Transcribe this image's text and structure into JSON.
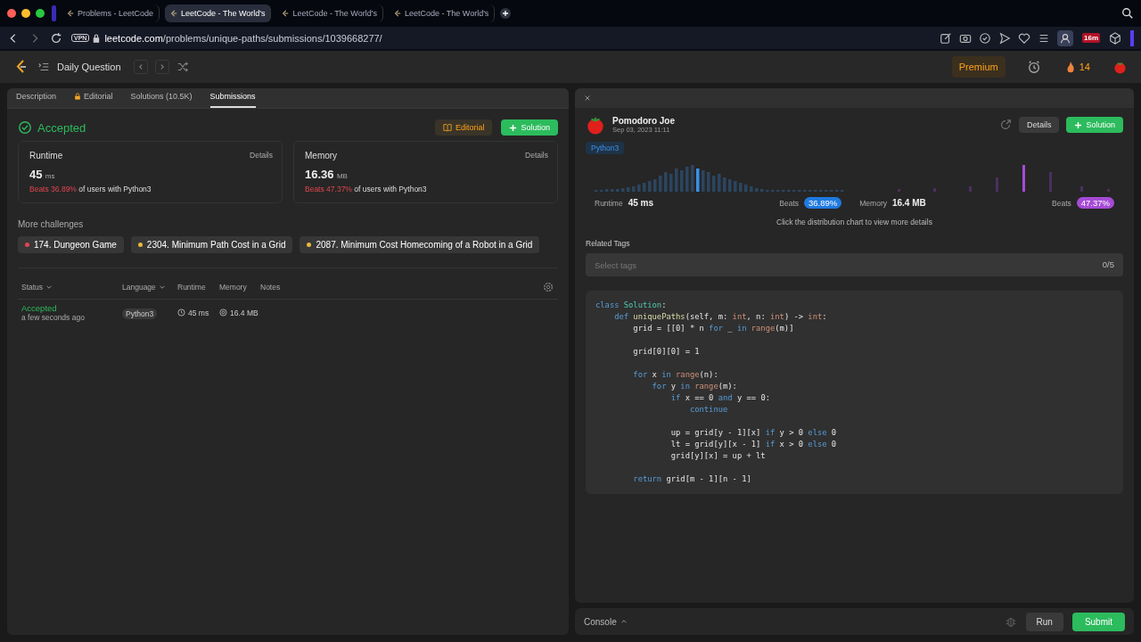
{
  "browser": {
    "tabs": [
      {
        "label": "Problems - LeetCode",
        "selected": false
      },
      {
        "label": "LeetCode - The World's",
        "selected": true
      },
      {
        "label": "LeetCode - The World's",
        "selected": false
      },
      {
        "label": "LeetCode - The World's",
        "selected": false
      }
    ],
    "url_host": "leetcode.com",
    "url_path": "/problems/unique-paths/submissions/1039668277/",
    "vpn": "VPN",
    "timer_badge": "16m"
  },
  "header": {
    "title": "Daily Question",
    "premium": "Premium",
    "streak": "14"
  },
  "left": {
    "tabs": [
      {
        "label": "Description",
        "selected": false,
        "locked": false
      },
      {
        "label": "Editorial",
        "selected": false,
        "locked": true
      },
      {
        "label": "Solutions (10.5K)",
        "selected": false,
        "locked": false
      },
      {
        "label": "Submissions",
        "selected": true,
        "locked": false
      }
    ],
    "status": "Accepted",
    "editorial_button": "Editorial",
    "solution_button": "Solution",
    "stats": [
      {
        "title": "Runtime",
        "details": "Details",
        "value": "45",
        "unit": "ms",
        "beats": "Beats 36.89%",
        "suffix": "of users with Python3"
      },
      {
        "title": "Memory",
        "details": "Details",
        "value": "16.36",
        "unit": "MB",
        "beats": "Beats 47.37%",
        "suffix": "of users with Python3"
      }
    ],
    "more_title": "More challenges",
    "challenges": [
      {
        "label": "174. Dungeon Game",
        "color": "#e0454f"
      },
      {
        "label": "2304. Minimum Path Cost in a Grid",
        "color": "#e8b93a"
      },
      {
        "label": "2087. Minimum Cost Homecoming of a Robot in a Grid",
        "color": "#e8b93a"
      }
    ],
    "columns": [
      {
        "label": "Status",
        "sortable": true
      },
      {
        "label": "Language",
        "sortable": true
      },
      {
        "label": "Runtime",
        "sortable": false
      },
      {
        "label": "Memory",
        "sortable": false
      },
      {
        "label": "Notes",
        "sortable": false
      }
    ],
    "rows": [
      {
        "status": "Accepted",
        "time": "a few seconds ago",
        "language": "Python3",
        "runtime": "45 ms",
        "memory": "16.4 MB"
      }
    ]
  },
  "right": {
    "author": "Pomodoro Joe",
    "date": "Sep 03, 2023 11:11",
    "details_button": "Details",
    "solution_button": "Solution",
    "language": "Python3",
    "runtime_label": "Runtime",
    "runtime": "45 ms",
    "runtime_beats_label": "Beats",
    "runtime_beats": "36.89%",
    "memory_label": "Memory",
    "memory": "16.4 MB",
    "memory_beats_label": "Beats",
    "memory_beats": "47.37%",
    "chart_hint": "Click the distribution chart to view more details",
    "tags_label": "Related Tags",
    "tags_placeholder": "Select tags",
    "tags_count": "0/5",
    "code_blocks": [
      {
        "lines": [
          [
            {
              "kind": "keyword",
              "text": "class"
            },
            {
              "kind": "type",
              "text": " Solution"
            },
            {
              "kind": "plain",
              "text": ":"
            }
          ],
          [
            {
              "kind": "keyword",
              "text": "    def"
            },
            {
              "kind": "function",
              "text": " uniquePaths"
            },
            {
              "kind": "plain",
              "text": "(self, m: "
            },
            {
              "kind": "builtin",
              "text": "int"
            },
            {
              "kind": "plain",
              "text": ", n: "
            },
            {
              "kind": "builtin",
              "text": "int"
            },
            {
              "kind": "plain",
              "text": ") -> "
            },
            {
              "kind": "builtin",
              "text": "int"
            },
            {
              "kind": "plain",
              "text": ":"
            }
          ],
          [
            {
              "kind": "plain",
              "text": "        grid = [[0] * n "
            },
            {
              "kind": "keyword",
              "text": "for"
            },
            {
              "kind": "plain",
              "text": " _ "
            },
            {
              "kind": "keyword",
              "text": "in"
            },
            {
              "kind": "builtin",
              "text": " range"
            },
            {
              "kind": "plain",
              "text": "(m)]"
            }
          ]
        ]
      },
      {
        "lines": [
          [
            {
              "kind": "plain",
              "text": "        grid[0][0] = 1"
            }
          ]
        ]
      },
      {
        "lines": [
          [
            {
              "kind": "keyword",
              "text": "        for"
            },
            {
              "kind": "plain",
              "text": " x "
            },
            {
              "kind": "keyword",
              "text": "in"
            },
            {
              "kind": "builtin",
              "text": " range"
            },
            {
              "kind": "plain",
              "text": "(n):"
            }
          ],
          [
            {
              "kind": "keyword",
              "text": "            for"
            },
            {
              "kind": "plain",
              "text": " y "
            },
            {
              "kind": "keyword",
              "text": "in"
            },
            {
              "kind": "builtin",
              "text": " range"
            },
            {
              "kind": "plain",
              "text": "(m):"
            }
          ],
          [
            {
              "kind": "keyword",
              "text": "                if"
            },
            {
              "kind": "plain",
              "text": " x == 0 "
            },
            {
              "kind": "keyword",
              "text": "and"
            },
            {
              "kind": "plain",
              "text": " y == 0:"
            }
          ],
          [
            {
              "kind": "keyword",
              "text": "                    continue"
            }
          ]
        ]
      },
      {
        "lines": [
          [
            {
              "kind": "plain",
              "text": "                up = grid[y - 1][x] "
            },
            {
              "kind": "keyword",
              "text": "if"
            },
            {
              "kind": "plain",
              "text": " y > 0 "
            },
            {
              "kind": "keyword",
              "text": "else"
            },
            {
              "kind": "plain",
              "text": " 0"
            }
          ],
          [
            {
              "kind": "plain",
              "text": "                lt = grid[y][x - 1] "
            },
            {
              "kind": "keyword",
              "text": "if"
            },
            {
              "kind": "plain",
              "text": " x > 0 "
            },
            {
              "kind": "keyword",
              "text": "else"
            },
            {
              "kind": "plain",
              "text": " 0"
            }
          ],
          [
            {
              "kind": "plain",
              "text": "                grid[y][x] = up + lt"
            }
          ]
        ]
      },
      {
        "lines": [
          [
            {
              "kind": "keyword",
              "text": "        return"
            },
            {
              "kind": "plain",
              "text": " grid[m - 1][n - 1]"
            }
          ]
        ]
      }
    ],
    "console": "Console",
    "run_button": "Run",
    "submit_button": "Submit"
  }
}
